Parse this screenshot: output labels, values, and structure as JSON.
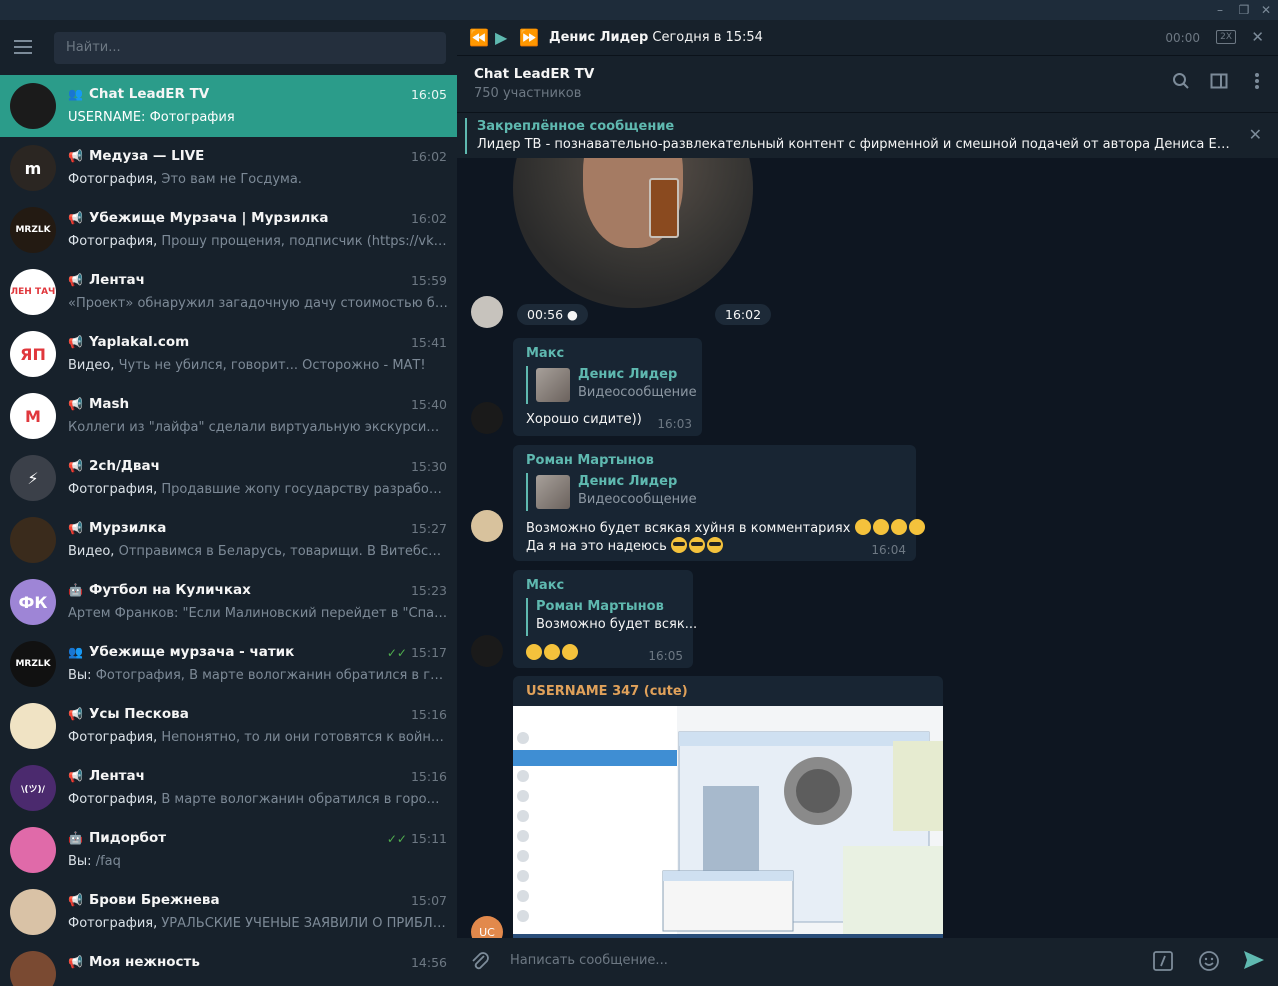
{
  "search": {
    "placeholder": "Найти..."
  },
  "chats": [
    {
      "name": "Chat LeadER TV",
      "type": "group",
      "time": "16:05",
      "prefix": "",
      "preview": "USERNAME: Фотография",
      "avatar_color": "#1b1b1b",
      "avatar_text": "",
      "active": true
    },
    {
      "name": "Медуза — LIVE",
      "type": "channel",
      "time": "16:02",
      "prefix": "Фотография,",
      "preview": " Это вам не Госдума.",
      "avatar_color": "#2b2622",
      "avatar_text": "m"
    },
    {
      "name": "Убежище Мурзача | Мурзилка",
      "type": "channel",
      "time": "16:02",
      "prefix": "Фотография,",
      "preview": " Прошу прощения, подписчик (https://vk.com/...",
      "avatar_color": "#231a12",
      "avatar_text": "MRZLK"
    },
    {
      "name": "Лентач",
      "type": "channel",
      "time": "15:59",
      "prefix": "",
      "preview": "«Проект» обнаружил загадочную дачу стоимостью более ...",
      "avatar_color": "#ffffff",
      "avatar_text": "ЛЕН ТАЧ"
    },
    {
      "name": "Yaplakal.com",
      "type": "channel",
      "time": "15:41",
      "prefix": "Видео,",
      "preview": " Чуть не убился, говорит... Осторожно - МАТ!",
      "avatar_color": "#ffffff",
      "avatar_text": "ЯП"
    },
    {
      "name": "Mash",
      "type": "channel",
      "time": "15:40",
      "prefix": "",
      "preview": "Коллеги из \"лайфа\" сделали виртуальную экскурсию по ка...",
      "avatar_color": "#ffffff",
      "avatar_text": "M"
    },
    {
      "name": "2ch/Двач",
      "type": "channel",
      "time": "15:30",
      "prefix": "Фотография,",
      "preview": " Продавшие жопу государству разработчики ...",
      "avatar_color": "#3b4049",
      "avatar_text": "⚡"
    },
    {
      "name": "Мурзилка",
      "type": "channel",
      "time": "15:27",
      "prefix": "Видео,",
      "preview": " Отправимся в Беларусь, товарищи. В Витебске вспл...",
      "avatar_color": "#3a2b1c",
      "avatar_text": ""
    },
    {
      "name": "Футбол на Куличках",
      "type": "bot",
      "time": "15:23",
      "prefix": "",
      "preview": "Артем Франков: \"Если Малиновский перейдет в \"Спартак\", ...",
      "avatar_color": "#9e85d6",
      "avatar_text": "ФК"
    },
    {
      "name": "Убежище мурзача - чатик",
      "type": "group",
      "time": "15:17",
      "read": true,
      "prefix": "Вы:",
      "preview": " Фотография, В марте вологжанин обратился в городск...",
      "avatar_color": "#111111",
      "avatar_text": "MRZLK"
    },
    {
      "name": "Усы Пескова",
      "type": "channel",
      "time": "15:16",
      "prefix": "Фотография,",
      "preview": " Непонятно, то ли они готовятся к войне с Кор...",
      "avatar_color": "#f0e3c4",
      "avatar_text": ""
    },
    {
      "name": "Лентач",
      "type": "channel",
      "time": "15:16",
      "prefix": "Фотография,",
      "preview": " В марте вологжанин обратился в городскую ...",
      "avatar_color": "#4b2a6e",
      "avatar_text": "\\(ツ)/"
    },
    {
      "name": "Пидорбот",
      "type": "bot",
      "time": "15:11",
      "read": true,
      "prefix": "Вы:",
      "preview": " /faq",
      "avatar_color": "#e06aa9",
      "avatar_text": ""
    },
    {
      "name": "Брови Брежнева",
      "type": "channel",
      "time": "15:07",
      "prefix": "Фотография,",
      "preview": " УРАЛЬСКИЕ УЧЁНЫЕ ЗАЯВИЛИ О ПРИБЛИЖЕ...",
      "avatar_color": "#d9c2a6",
      "avatar_text": ""
    },
    {
      "name": "Моя нежность",
      "type": "channel",
      "time": "14:56",
      "prefix": "",
      "preview": "",
      "avatar_color": "#7a4a32",
      "avatar_text": ""
    }
  ],
  "player": {
    "title": "Денис Лидер",
    "date": "Сегодня в 15:54",
    "time": "00:00",
    "speed": "2X"
  },
  "header": {
    "title": "Chat LeadER TV",
    "subtitle": "750 участников"
  },
  "pinned": {
    "title": "Закреплённое сообщение",
    "text": "Лидер ТВ - познавательно-развлекательный контент с фирменной и смешной подачей от автора Дениса Ерохина. То..."
  },
  "messages": {
    "video": {
      "duration": "00:56",
      "time": "16:02"
    },
    "m1": {
      "sender": "Макс",
      "sender_color": "#5fb9b0",
      "reply_name": "Денис Лидер",
      "reply_text": "Видеосообщение",
      "text": "Хорошо сидите))",
      "time": "16:03"
    },
    "m2": {
      "sender": "Роман Мартынов",
      "sender_color": "#5fb9b0",
      "reply_name": "Денис Лидер",
      "reply_text": "Видеосообщение",
      "text1": "Возможно будет всякая хуйня в комментариях",
      "text2": "Да я на это надеюсь",
      "time": "16:04"
    },
    "m3": {
      "sender": "Макс",
      "sender_color": "#5fb9b0",
      "reply_name": "Роман Мартынов",
      "reply_text": "Возможно будет всяк...",
      "time": "16:05"
    },
    "m4": {
      "sender": "USERNAME 347 (cute)",
      "sender_color": "#e0a15a",
      "avatar_text": "UC"
    }
  },
  "composer": {
    "placeholder": "Написать сообщение..."
  },
  "colors": {
    "accent": "#5fb9b0",
    "active_chat": "#2b9c8a",
    "sidebar": "#17212b",
    "background": "#0e1621"
  }
}
